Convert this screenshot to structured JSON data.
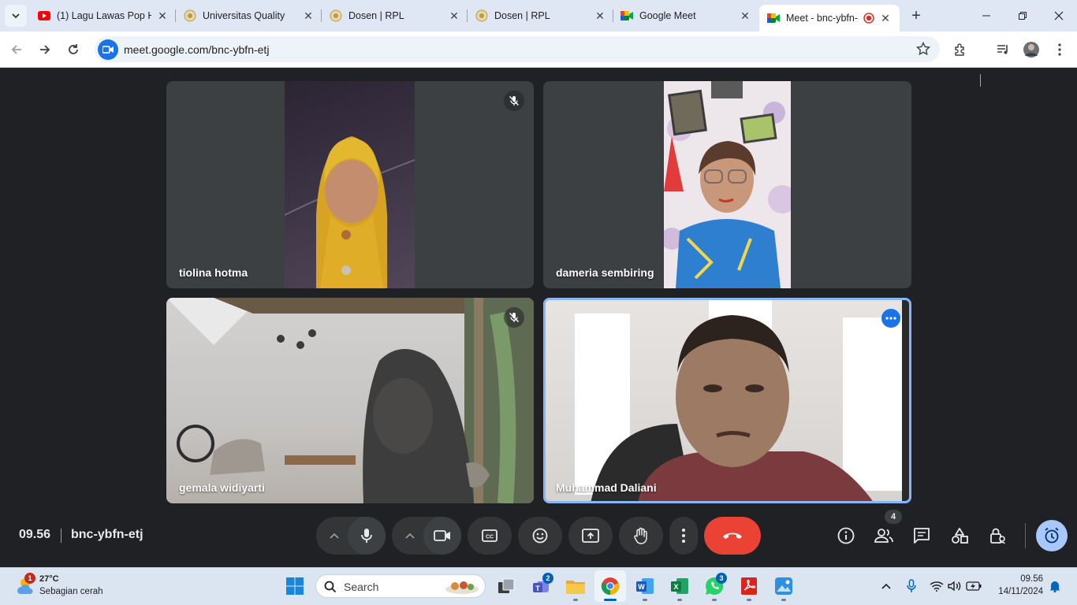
{
  "browser": {
    "tabs": [
      {
        "title": "(1) Lagu Lawas Pop H",
        "favicon": "youtube-icon"
      },
      {
        "title": "Universitas Quality",
        "favicon": "university-crest-icon"
      },
      {
        "title": "Dosen | RPL",
        "favicon": "university-crest-icon"
      },
      {
        "title": "Dosen | RPL",
        "favicon": "university-crest-icon"
      },
      {
        "title": "Google Meet",
        "favicon": "google-meet-icon"
      },
      {
        "title": "Meet - bnc-ybfn-",
        "favicon": "google-meet-icon",
        "active": true,
        "recording": true
      }
    ],
    "url": "meet.google.com/bnc-ybfn-etj"
  },
  "meet": {
    "participants": [
      {
        "name": "tiolina hotma",
        "muted": true
      },
      {
        "name": "dameria sembiring",
        "muted": false
      },
      {
        "name": "gemala widiyarti",
        "muted": true
      },
      {
        "name": "Muhammad Daliani",
        "muted": false,
        "active_speaker": true
      }
    ],
    "time": "09.56",
    "meeting_code": "bnc-ybfn-etj",
    "people_count": "4",
    "colors": {
      "end_call": "#ea4335",
      "active_border": "#8ab4f8",
      "background": "#202124"
    }
  },
  "taskbar": {
    "weather": {
      "badge": "1",
      "temp": "27°C",
      "desc": "Sebagian cerah"
    },
    "search_placeholder": "Search",
    "badges": {
      "teams": "2",
      "whatsapp": "3"
    },
    "clock": {
      "time": "09.56",
      "date": "14/11/2024"
    }
  }
}
